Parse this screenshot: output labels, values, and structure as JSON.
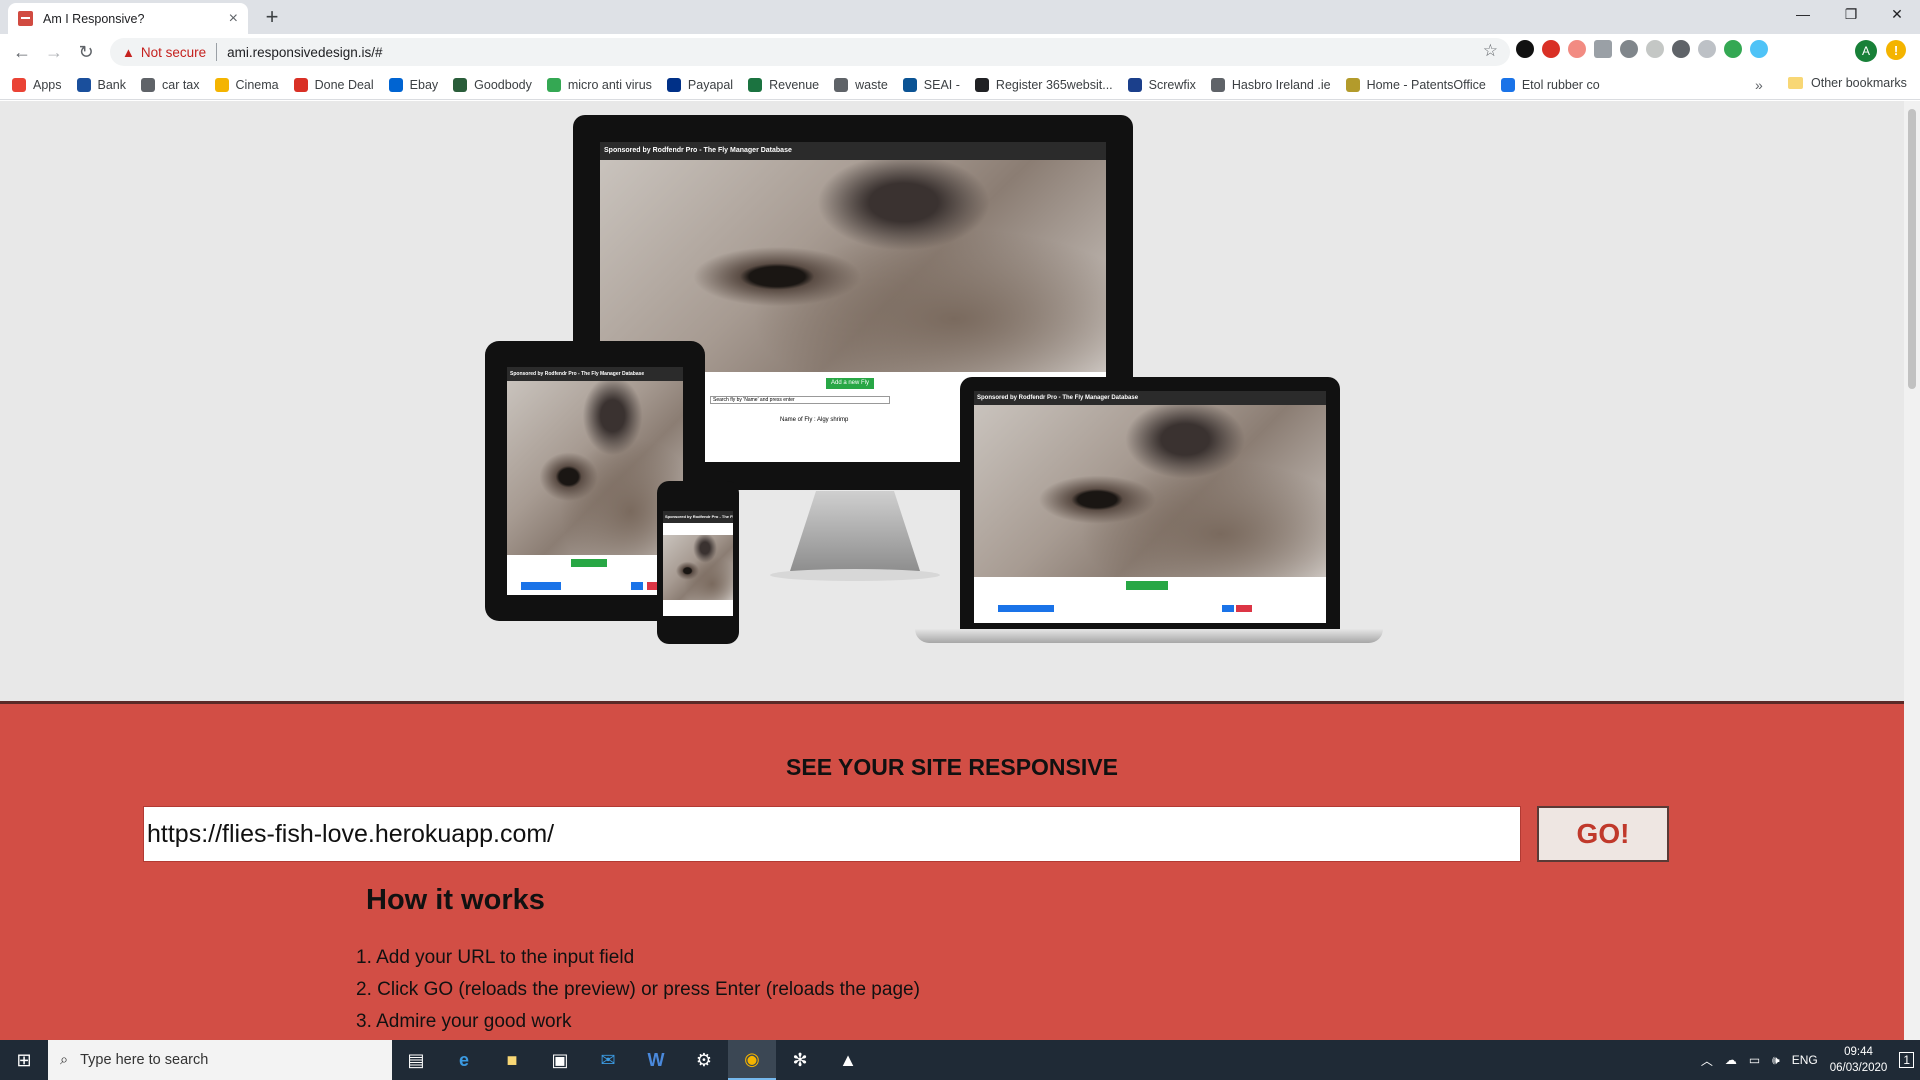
{
  "browser": {
    "tab_title": "Am I Responsive?",
    "tab_close": "×",
    "new_tab": "+",
    "security_label": "Not secure",
    "url": "ami.responsivedesign.is/#",
    "profile_initial": "A",
    "bookmarks": [
      {
        "label": "Apps",
        "color": "#ea4335"
      },
      {
        "label": "Bank",
        "color": "#1a4f9c"
      },
      {
        "label": "car tax",
        "color": "#5f6368"
      },
      {
        "label": "Cinema",
        "color": "#f4b400"
      },
      {
        "label": "Done Deal",
        "color": "#d93025"
      },
      {
        "label": "Ebay",
        "color": "#0064d2"
      },
      {
        "label": "Goodbody",
        "color": "#2a5d3a"
      },
      {
        "label": "micro anti virus",
        "color": "#34a853"
      },
      {
        "label": "Payapal",
        "color": "#003087"
      },
      {
        "label": "Revenue",
        "color": "#1b7340"
      },
      {
        "label": "waste",
        "color": "#5f6368"
      },
      {
        "label": "SEAI -",
        "color": "#0b5394"
      },
      {
        "label": "Register 365websit...",
        "color": "#202124"
      },
      {
        "label": "Screwfix",
        "color": "#1b3f8b"
      },
      {
        "label": "Hasbro Ireland .ie",
        "color": "#5f6368"
      },
      {
        "label": "Home - PatentsOffice",
        "color": "#b39b2b"
      },
      {
        "label": "Etol rubber co",
        "color": "#1a73e8"
      }
    ],
    "other_bookmarks": "Other bookmarks"
  },
  "mockup": {
    "site_header": "Sponsored by Rodfendr Pro - The Fly Manager Database",
    "add_button": "Add a new Fly",
    "search_placeholder": "Search fly by 'Name' and press enter",
    "record_text": "Name of Fly : Algy shrimp"
  },
  "page": {
    "section_title": "SEE YOUR SITE RESPONSIVE",
    "url_value": "https://flies-fish-love.herokuapp.com/",
    "go_label": "GO!",
    "how_title": "How it works",
    "steps": [
      "1. Add your URL to the input field",
      "2. Click GO (reloads the preview) or press Enter (reloads the page)",
      "3. Admire your good work"
    ]
  },
  "taskbar": {
    "search_placeholder": "Type here to search",
    "language": "ENG",
    "time": "09:44",
    "date": "06/03/2020",
    "notification_count": "1"
  }
}
